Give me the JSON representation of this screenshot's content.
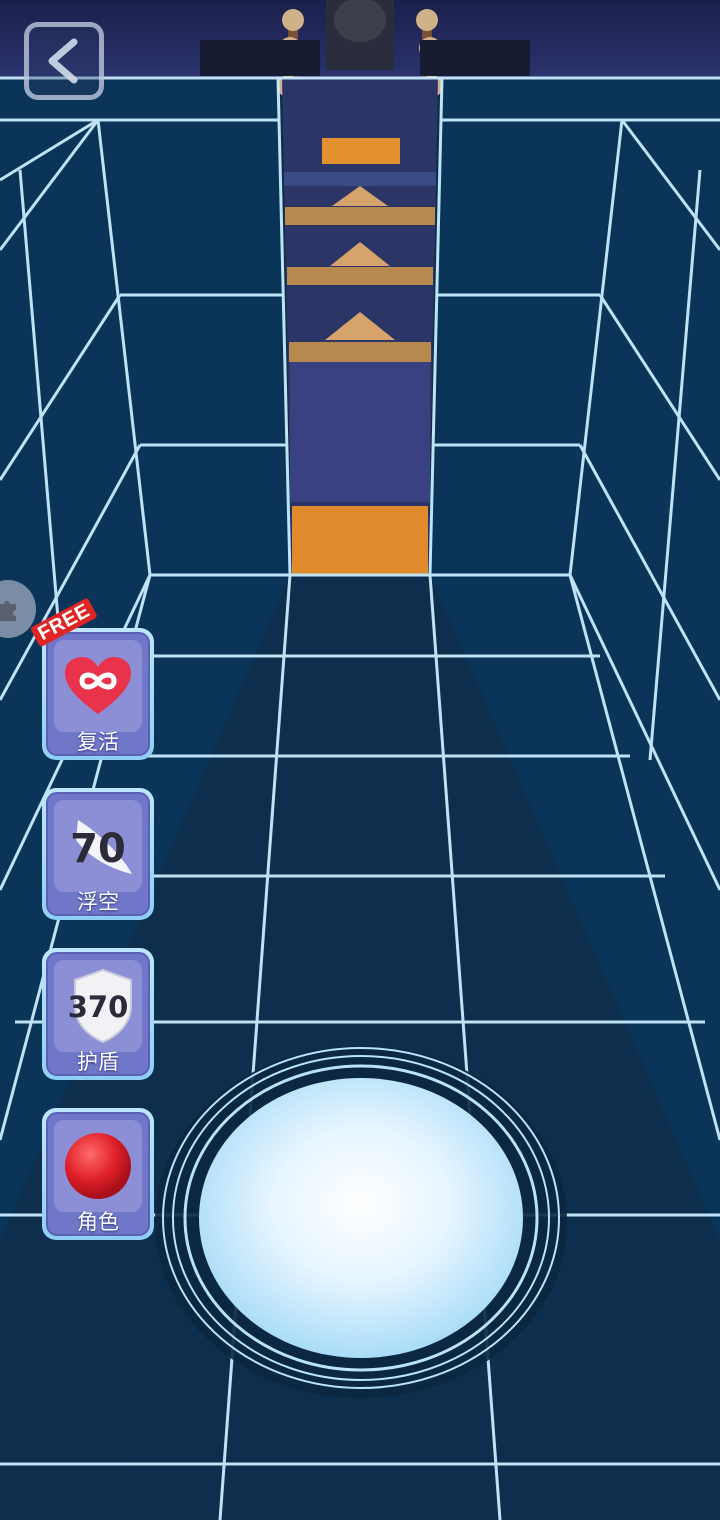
{
  "top_bar": {
    "back_icon": "chevron-left-icon"
  },
  "side_menu": {
    "icon": "puzzle-icon"
  },
  "powerups": [
    {
      "id": "revive",
      "label": "复活",
      "icon": "infinite-heart-icon",
      "badge": "FREE",
      "count": ""
    },
    {
      "id": "float",
      "label": "浮空",
      "icon": "feather-icon",
      "count": "70"
    },
    {
      "id": "shield",
      "label": "护盾",
      "icon": "shield-icon",
      "count": "370"
    },
    {
      "id": "character",
      "label": "角色",
      "icon": "red-ball-icon",
      "count": ""
    }
  ],
  "controls": {
    "jump_icon": "glowing-orb-button"
  },
  "colors": {
    "floor": "#0d2f4d",
    "grid_line": "#c9ecff",
    "orange_tile": "#e08a2e",
    "powerup_bg": "#7077c9"
  }
}
